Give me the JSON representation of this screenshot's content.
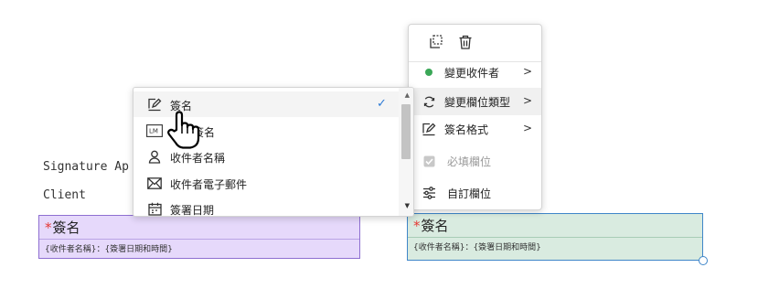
{
  "doc_text": {
    "line1": "Signature Ap",
    "line2": "Client"
  },
  "fields": {
    "left": {
      "required_mark": "*",
      "title": "簽名",
      "subtitle": "{收件者名稱}：{簽署日期和時間}"
    },
    "right": {
      "required_mark": "*",
      "title": "簽名",
      "subtitle": "{收件者名稱}：{簽署日期和時間}"
    }
  },
  "context_menu": {
    "toolbar": [
      "copy-icon",
      "trash-icon"
    ],
    "items": [
      {
        "label": "變更收件者",
        "icon": "green-dot-icon",
        "submenu": true
      },
      {
        "label": "變更欄位類型",
        "icon": "swap-icon",
        "submenu": true,
        "hover": true
      },
      {
        "label": "簽名格式",
        "icon": "signature-pen-icon",
        "submenu": true
      },
      {
        "label": "必填欄位",
        "icon": "checkbox-icon",
        "disabled": true
      },
      {
        "label": "自訂欄位",
        "icon": "sliders-icon"
      }
    ]
  },
  "field_type_list": {
    "items": [
      {
        "label": "簽名",
        "icon": "signature-pen-icon",
        "selected": true
      },
      {
        "label": "簽名",
        "icon": "initials-icon"
      },
      {
        "label": "收件者名稱",
        "icon": "person-icon"
      },
      {
        "label": "收件者電子郵件",
        "icon": "envelope-icon"
      },
      {
        "label": "簽署日期",
        "icon": "calendar-icon"
      }
    ],
    "scroll_position": 0
  },
  "colors": {
    "accent_blue": "#2d7bd5",
    "green_dot": "#3aa757",
    "required_red": "#e53935"
  }
}
